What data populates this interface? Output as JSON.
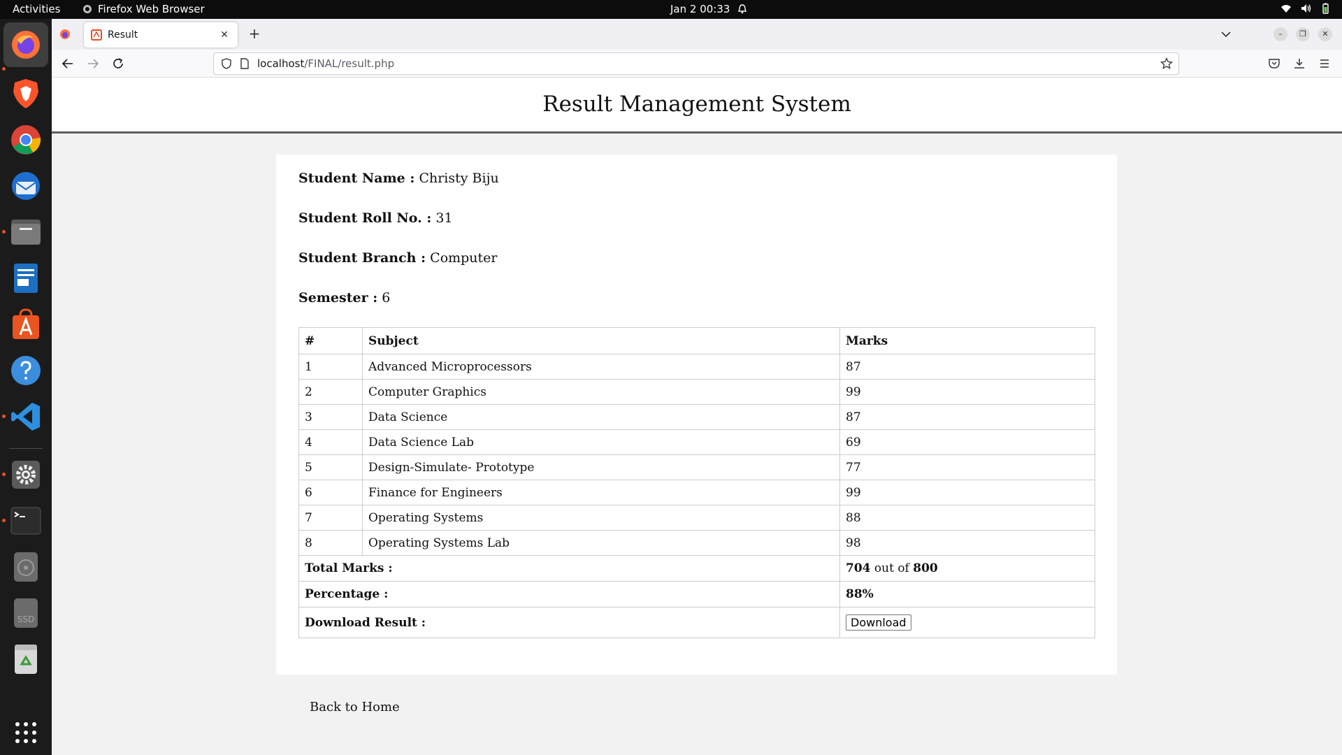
{
  "topbar": {
    "activities": "Activities",
    "app_name": "Firefox Web Browser",
    "clock": "Jan 2  00:33"
  },
  "dock": {
    "items": [
      "firefox",
      "brave",
      "chrome",
      "thunderbird",
      "files",
      "writer",
      "app-center",
      "help",
      "vscode",
      "settings",
      "terminal",
      "disk",
      "ssd",
      "trash",
      "show-apps"
    ],
    "ssd_label": "SSD"
  },
  "browser": {
    "tab_title": "Result",
    "url_host": "localhost",
    "url_path": "/FINAL/result.php"
  },
  "page": {
    "site_title": "Result Management System",
    "student": {
      "name_label": "Student Name :",
      "name": "Christy Biju",
      "roll_label": "Student Roll No. :",
      "roll": "31",
      "branch_label": "Student Branch :",
      "branch": "Computer",
      "semester_label": "Semester :",
      "semester": "6"
    },
    "table": {
      "headers": [
        "#",
        "Subject",
        "Marks"
      ],
      "rows": [
        {
          "num": "1",
          "subject": "Advanced Microprocessors",
          "marks": "87"
        },
        {
          "num": "2",
          "subject": "Computer Graphics",
          "marks": "99"
        },
        {
          "num": "3",
          "subject": "Data Science",
          "marks": "87"
        },
        {
          "num": "4",
          "subject": "Data Science Lab",
          "marks": "69"
        },
        {
          "num": "5",
          "subject": "Design-Simulate- Prototype",
          "marks": "77"
        },
        {
          "num": "6",
          "subject": "Finance for Engineers",
          "marks": "99"
        },
        {
          "num": "7",
          "subject": "Operating Systems",
          "marks": "88"
        },
        {
          "num": "8",
          "subject": "Operating Systems Lab",
          "marks": "98"
        }
      ],
      "total_label": "Total Marks :",
      "total": "704",
      "out_of_text": "out of",
      "max": "800",
      "percentage_label": "Percentage :",
      "percentage": "88%",
      "download_label": "Download Result :",
      "download_button": "Download"
    },
    "back_link": "Back to Home"
  }
}
